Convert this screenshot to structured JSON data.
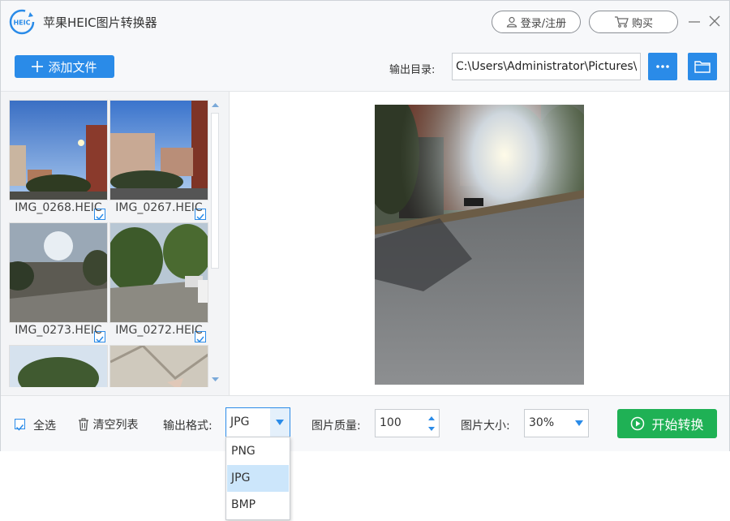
{
  "app": {
    "title": "苹果HEIC图片转换器",
    "logo_text": "HEIC"
  },
  "header": {
    "login_label": "登录/注册",
    "buy_label": "购买"
  },
  "toolbar": {
    "add_file_label": "添加文件",
    "output_dir_label": "输出目录:",
    "output_dir_value": "C:\\Users\\Administrator\\Pictures\\"
  },
  "thumbnails": [
    {
      "name": "IMG_0268.HEIC",
      "checked": true
    },
    {
      "name": "IMG_0267.HEIC",
      "checked": true
    },
    {
      "name": "IMG_0273.HEIC",
      "checked": true
    },
    {
      "name": "IMG_0272.HEIC",
      "checked": true
    }
  ],
  "bottom": {
    "select_all_label": "全选",
    "clear_list_label": "清空列表",
    "format_label": "输出格式:",
    "format_value": "JPG",
    "quality_label": "图片质量:",
    "quality_value": "100",
    "size_label": "图片大小:",
    "size_value": "30%",
    "start_label": "开始转换"
  },
  "format_dropdown": {
    "options": [
      "PNG",
      "JPG",
      "BMP"
    ],
    "selected": "JPG"
  },
  "colors": {
    "accent": "#2a8be8",
    "start_green": "#1fb155",
    "selection": "#cce6fb"
  }
}
